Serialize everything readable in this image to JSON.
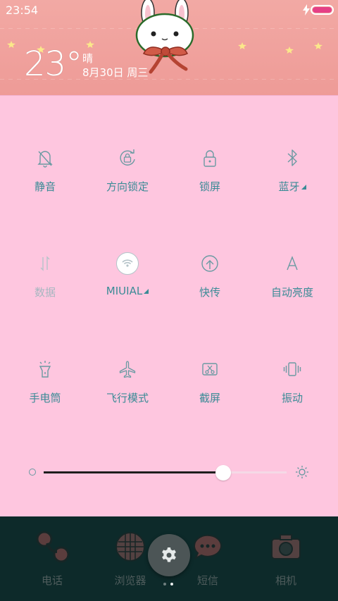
{
  "status_bar": {
    "time": "23:54",
    "battery_color": "#e53f86"
  },
  "weather": {
    "temperature": "23°",
    "condition": "晴",
    "date": "8月30日 周三"
  },
  "quick_settings": {
    "tiles": [
      {
        "label": "静音",
        "icon": "silent-bell-icon",
        "dim": false
      },
      {
        "label": "方向锁定",
        "icon": "rotation-lock-icon",
        "dim": false
      },
      {
        "label": "锁屏",
        "icon": "lock-icon",
        "dim": false
      },
      {
        "label": "蓝牙",
        "icon": "bluetooth-icon",
        "dim": false,
        "has_more": true
      },
      {
        "label": "数据",
        "icon": "mobile-data-icon",
        "dim": true
      },
      {
        "label": "MIUIAL",
        "icon": "wifi-icon",
        "dim": false,
        "has_more": true
      },
      {
        "label": "快传",
        "icon": "quick-transfer-icon",
        "dim": false
      },
      {
        "label": "自动亮度",
        "icon": "auto-brightness-icon",
        "dim": false
      },
      {
        "label": "手电筒",
        "icon": "flashlight-icon",
        "dim": false
      },
      {
        "label": "飞行模式",
        "icon": "airplane-icon",
        "dim": false
      },
      {
        "label": "截屏",
        "icon": "screenshot-icon",
        "dim": false
      },
      {
        "label": "振动",
        "icon": "vibrate-icon",
        "dim": false
      }
    ],
    "brightness_level": 0.74,
    "accent_color": "#3a8b96",
    "panel_color": "#fec6df"
  },
  "dock": {
    "apps": [
      {
        "label": "电话",
        "icon": "phone-icon"
      },
      {
        "label": "浏览器",
        "icon": "browser-icon"
      },
      {
        "label": "短信",
        "icon": "messages-icon"
      },
      {
        "label": "相机",
        "icon": "camera-icon"
      }
    ],
    "settings_icon": "gear-icon"
  }
}
